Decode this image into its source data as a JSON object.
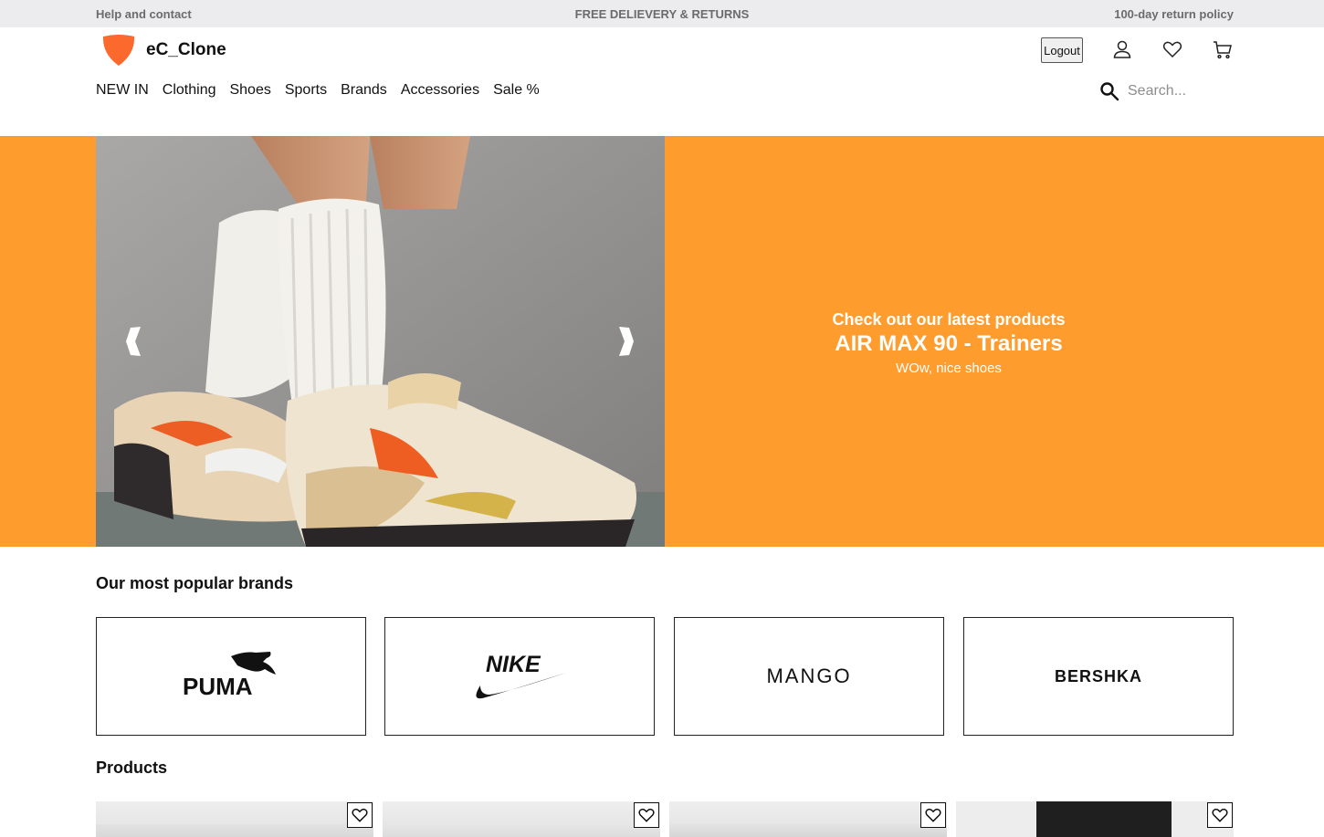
{
  "topbar": {
    "help": "Help and contact",
    "promo": "FREE DELIEVERY & RETURNS",
    "policy": "100-day return policy"
  },
  "header": {
    "logo_text": "eC_Clone",
    "logout_label": "Logout",
    "icons": [
      "user-icon",
      "heart-icon",
      "cart-icon"
    ]
  },
  "nav": {
    "items": [
      "NEW IN",
      "Clothing",
      "Shoes",
      "Sports",
      "Brands",
      "Accessories",
      "Sale %"
    ]
  },
  "search": {
    "placeholder": "Search..."
  },
  "hero": {
    "subtitle": "Check out our latest products",
    "title": "AIR MAX 90 - Trainers",
    "tagline": "WOw, nice shoes",
    "bg_color": "#fe9c2d"
  },
  "brands": {
    "title": "Our most popular brands",
    "items": [
      "PUMA",
      "NIKE",
      "MANGO",
      "BERSHKA"
    ]
  },
  "products": {
    "title": "Products"
  },
  "colors": {
    "accent": "#fe9c2d",
    "logo": "#fb6a2c"
  }
}
